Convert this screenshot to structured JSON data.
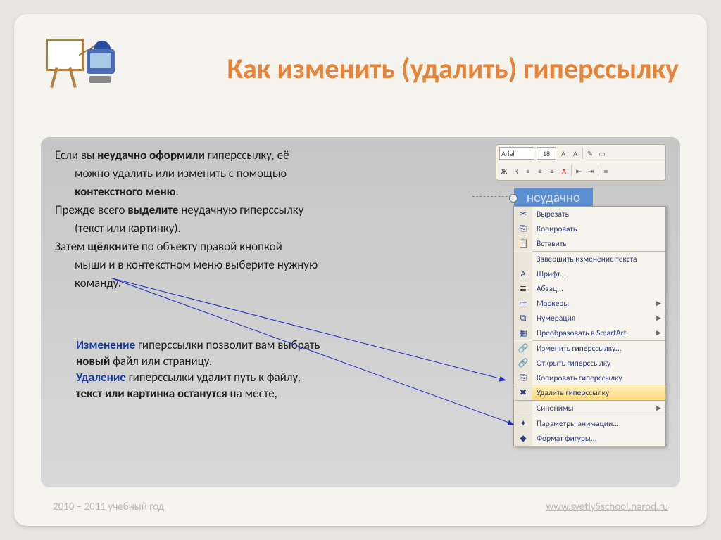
{
  "title": "Как изменить (удалить) гиперссылку",
  "body": {
    "l1a": "Если вы ",
    "l1b": "неудачно оформили ",
    "l1c": "гиперссылку, её",
    "l2": "можно удалить или изменить с помощью",
    "l3": "контекстного меню",
    "l3b": ".",
    "l4a": "Прежде всего ",
    "l4b": "выделите ",
    "l4c": "неудачную гиперссылку",
    "l5": "(текст или картинку).",
    "l6a": "Затем ",
    "l6b": "щёлкните ",
    "l6c": "по объекту правой кнопкой",
    "l7": "мыши и в контекстном меню выберите нужную",
    "l8": "команду."
  },
  "note": {
    "n1a": "Изменение ",
    "n1b": "гиперссылки позволит вам выбрать",
    "n2a": "новый ",
    "n2b": "файл или страницу.",
    "n3a": "Удаление ",
    "n3b": "гиперссылки удалит путь к файлу,",
    "n4a": "текст или картинка останутся ",
    "n4b": "на месте,"
  },
  "toolbar": {
    "font": "Arial",
    "size": "18"
  },
  "selected_word": "неудачно",
  "context_menu": [
    {
      "icon": "✂",
      "label": "Вырезать"
    },
    {
      "icon": "⎘",
      "label": "Копировать"
    },
    {
      "icon": "📋",
      "label": "Вставить"
    },
    {
      "sep": true
    },
    {
      "icon": "",
      "label": "Завершить изменение текста"
    },
    {
      "icon": "A",
      "label": "Шрифт..."
    },
    {
      "icon": "≣",
      "label": "Абзац..."
    },
    {
      "icon": "≔",
      "label": "Маркеры",
      "arrow": true
    },
    {
      "icon": "⧉",
      "label": "Нумерация",
      "arrow": true
    },
    {
      "icon": "▦",
      "label": "Преобразовать в SmartArt",
      "arrow": true
    },
    {
      "sep": true
    },
    {
      "icon": "🔗",
      "label": "Изменить гиперссылку..."
    },
    {
      "icon": "🔗",
      "label": "Открыть гиперссылку"
    },
    {
      "icon": "⎘",
      "label": "Копировать гиперссылку"
    },
    {
      "icon": "✖",
      "label": "Удалить гиперссылку",
      "hl": true
    },
    {
      "sep": true
    },
    {
      "icon": "",
      "label": "Синонимы",
      "arrow": true
    },
    {
      "sep": true
    },
    {
      "icon": "✦",
      "label": "Параметры анимации..."
    },
    {
      "icon": "◆",
      "label": "Формат фигуры..."
    }
  ],
  "footer": {
    "left": "2010 – 2011 учебный год",
    "right": "www.svetly5school.narod.ru"
  }
}
